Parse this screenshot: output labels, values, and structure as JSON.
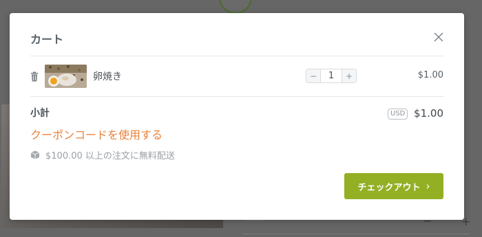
{
  "cart": {
    "title": "カート",
    "items": [
      {
        "name": "卵焼き",
        "quantity": "1",
        "price": "$1.00"
      }
    ],
    "subtotal_label": "小計",
    "currency": "USD",
    "subtotal": "$1.00",
    "coupon_link": "クーポンコードを使用する",
    "shipping_note": "$100.00 以上の注文に無料配送",
    "checkout_label": "チェックアウト",
    "colors": {
      "accent_orange": "#e9813a",
      "checkout_green": "#93b025"
    },
    "icons": {
      "close": "close-icon",
      "trash": "trash-icon",
      "box": "box-icon",
      "chevron": "chevron-right-icon"
    }
  }
}
